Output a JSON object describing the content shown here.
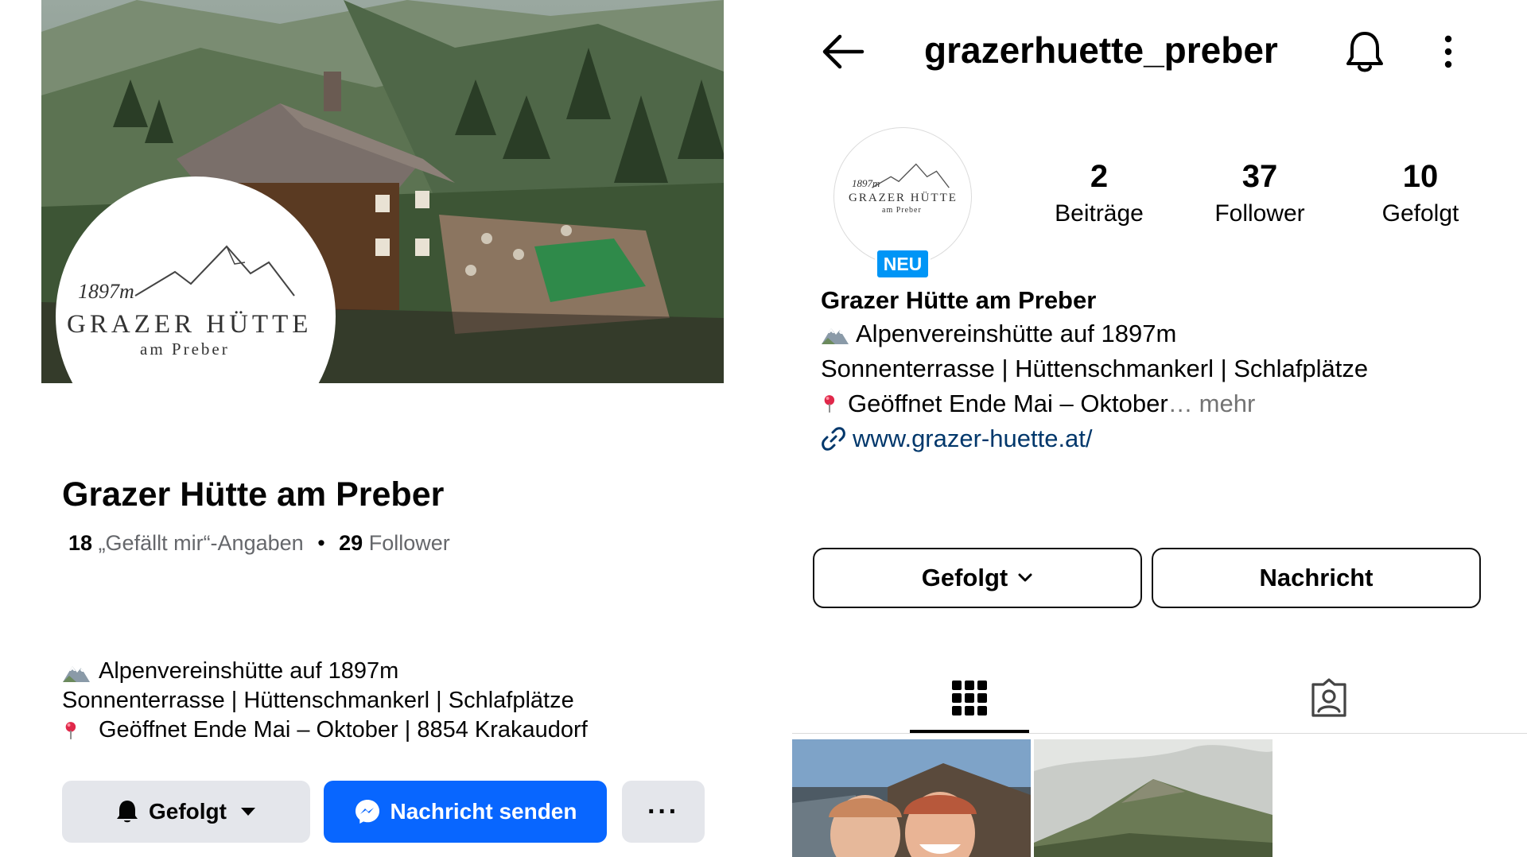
{
  "facebook": {
    "cover": {
      "logo_altitude": "1897m",
      "logo_name": "GRAZER HÜTTE",
      "logo_sub": "am Preber"
    },
    "page_name": "Grazer Hütte am Preber",
    "stats": {
      "likes_count": "18",
      "likes_label": "„Gefällt mir“-Angaben",
      "separator": "•",
      "followers_count": "29",
      "followers_label": "Follower"
    },
    "bio": {
      "line1": "Alpenvereinshütte auf 1897m",
      "line2": "Sonnenterrasse | Hüttenschmankerl | Schlafplätze",
      "line3": "Geöffnet Ende Mai – Oktober | 8854 Krakaudorf"
    },
    "buttons": {
      "follow_label": "Gefolgt",
      "message_label": "Nachricht senden",
      "more_label": "···"
    },
    "colors": {
      "brand_blue": "#0866ff",
      "button_gray": "#e4e6eb"
    }
  },
  "instagram": {
    "username": "grazerhuette_preber",
    "avatar": {
      "logo_altitude": "1897m",
      "logo_name": "GRAZER HÜTTE",
      "logo_sub": "am Preber",
      "badge": "NEU"
    },
    "stats": [
      {
        "num": "2",
        "label": "Beiträge"
      },
      {
        "num": "37",
        "label": "Follower"
      },
      {
        "num": "10",
        "label": "Gefolgt"
      }
    ],
    "display_name": "Grazer Hütte am Preber",
    "bio": {
      "line1": "Alpenvereinshütte auf 1897m",
      "line2": "Sonnenterrasse | Hüttenschmankerl | Schlafplätze",
      "line3": "Geöffnet Ende Mai – Oktober",
      "line3_ellipsis": "…",
      "more": "mehr",
      "link": "www.grazer-huette.at/"
    },
    "buttons": {
      "follow_label": "Gefolgt",
      "message_label": "Nachricht"
    },
    "tabs": {
      "active": "grid",
      "items": [
        "grid",
        "tagged"
      ]
    },
    "icons": [
      "back-arrow-icon",
      "bell-icon",
      "more-vertical-icon",
      "grid-icon",
      "tagged-person-icon",
      "link-icon",
      "mountain-emoji-icon",
      "pin-emoji-icon",
      "chevron-down-icon"
    ],
    "colors": {
      "neu_badge": "#0095f6",
      "link": "#00376b",
      "more": "#737373"
    }
  }
}
